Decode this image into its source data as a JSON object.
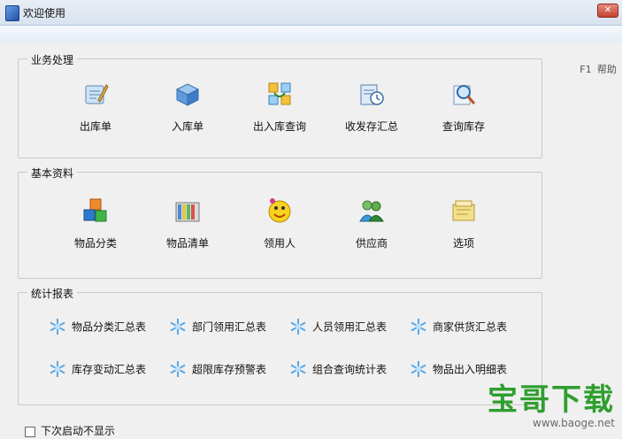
{
  "window": {
    "title": "欢迎使用",
    "close_label": "✕",
    "help": "F1 帮助"
  },
  "groups": [
    {
      "title": "业务处理",
      "items": [
        {
          "label": "出库单",
          "icon": "stock-out-icon"
        },
        {
          "label": "入库单",
          "icon": "stock-in-icon"
        },
        {
          "label": "出入库查询",
          "icon": "inout-query-icon"
        },
        {
          "label": "收发存汇总",
          "icon": "summary-icon"
        },
        {
          "label": "查询库存",
          "icon": "inventory-search-icon"
        }
      ]
    },
    {
      "title": "基本资料",
      "items": [
        {
          "label": "物品分类",
          "icon": "category-icon"
        },
        {
          "label": "物品清单",
          "icon": "item-list-icon"
        },
        {
          "label": "领用人",
          "icon": "recipient-icon"
        },
        {
          "label": "供应商",
          "icon": "supplier-icon"
        },
        {
          "label": "选项",
          "icon": "options-icon"
        }
      ]
    },
    {
      "title": "统计报表",
      "reports": [
        "物品分类汇总表",
        "部门领用汇总表",
        "人员领用汇总表",
        "商家供货汇总表",
        "库存变动汇总表",
        "超限库存预警表",
        "组合查询统计表",
        "物品出入明细表"
      ]
    }
  ],
  "footer": {
    "checkbox_label": "下次启动不显示",
    "checked": false
  },
  "watermark": {
    "main": "宝哥下载",
    "url": "www.baoge.net"
  }
}
